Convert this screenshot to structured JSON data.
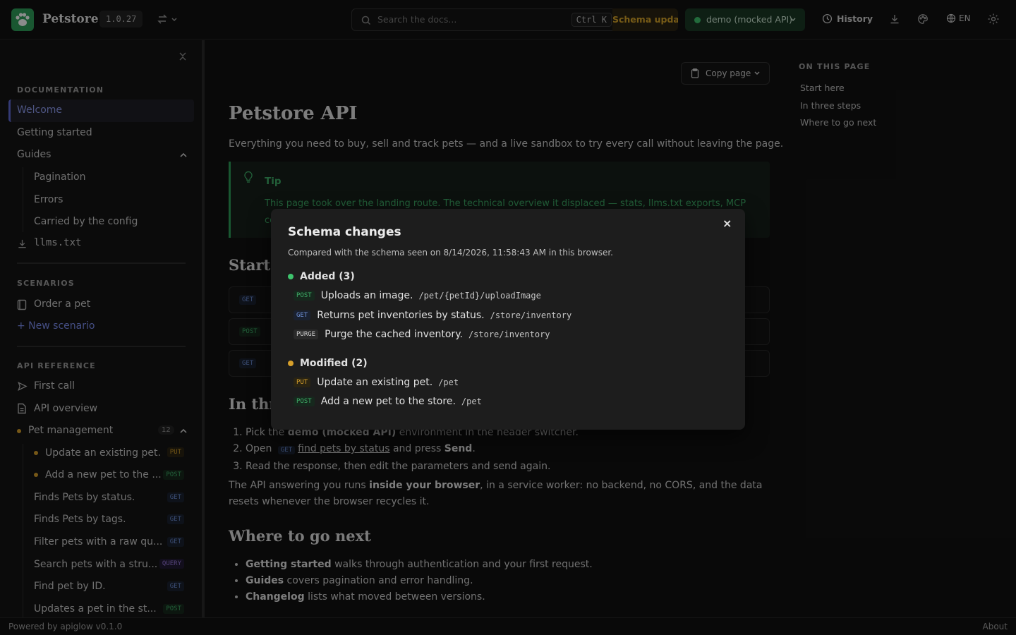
{
  "header": {
    "brand": "Petstore",
    "version": "1.0.27",
    "search_placeholder": "Search the docs...",
    "search_shortcut": "Ctrl K",
    "schema_badge": "Schema updated",
    "environment": "demo (mocked API)",
    "history": "History",
    "language": "EN"
  },
  "sidebar": {
    "documentation_title": "DOCUMENTATION",
    "doc_items": [
      "Welcome",
      "Getting started",
      "Guides"
    ],
    "guide_items": [
      "Pagination",
      "Errors",
      "Carried by the config"
    ],
    "llms": "llms.txt",
    "scenarios_title": "SCENARIOS",
    "scenario_item": "Order a pet",
    "new_scenario": "+ New scenario",
    "api_title": "API REFERENCE",
    "first_call": "First call",
    "api_overview": "API overview",
    "pet_group": "Pet management",
    "pet_count": "12",
    "endpoints": [
      {
        "label": "Update an existing pet.",
        "method": "PUT"
      },
      {
        "label": "Add a new pet to the ...",
        "method": "POST"
      },
      {
        "label": "Finds Pets by status.",
        "method": "GET"
      },
      {
        "label": "Finds Pets by tags.",
        "method": "GET"
      },
      {
        "label": "Filter pets with a raw qu...",
        "method": "GET"
      },
      {
        "label": "Search pets with a stru...",
        "method": "QUERY"
      },
      {
        "label": "Find pet by ID.",
        "method": "GET"
      },
      {
        "label": "Updates a pet in the st...",
        "method": "POST"
      }
    ]
  },
  "main": {
    "copy_page": "Copy page",
    "title": "Petstore API",
    "lead": "Everything you need to buy, sell and track pets — and a live sandbox to try every call without leaving the page.",
    "tip_label": "Tip",
    "tip_text": "This page took over the landing route. The technical overview it displaced — stats, llms.txt exports, MCP co",
    "h2_start": "Start here",
    "start_methods": [
      "GET",
      "POST",
      "GET"
    ],
    "h2_steps": "In three steps",
    "step1_a": "Pick the ",
    "step1_b": "demo (mocked API)",
    "step1_c": " environment in the header switcher.",
    "step2_a": "Open",
    "step2_method": "GET",
    "step2_link": "find pets by status",
    "step2_b": " and press ",
    "step2_c": "Send",
    "step2_d": ".",
    "step3": "Read the response, then edit the parameters and send again.",
    "para_a": "The API answering you runs ",
    "para_b": "inside your browser",
    "para_c": ", in a service worker: no backend, no CORS, and the data resets whenever the browser recycles it.",
    "h2_next": "Where to go next",
    "next": [
      {
        "bold": "Getting started",
        "rest": " walks through authentication and your first request."
      },
      {
        "bold": "Guides",
        "rest": " covers pagination and error handling."
      },
      {
        "bold": "Changelog",
        "rest": " lists what moved between versions."
      }
    ]
  },
  "toc": {
    "title": "ON THIS PAGE",
    "items": [
      "Start here",
      "In three steps",
      "Where to go next"
    ]
  },
  "dialog": {
    "title": "Schema changes",
    "subtitle": "Compared with the schema seen on 8/14/2026, 11:58:43 AM in this browser.",
    "added_title": "Added (3)",
    "added": [
      {
        "method": "POST",
        "summary": "Uploads an image.",
        "path": "/pet/{petId}/uploadImage"
      },
      {
        "method": "GET",
        "summary": "Returns pet inventories by status.",
        "path": "/store/inventory"
      },
      {
        "method": "PURGE",
        "summary": "Purge the cached inventory.",
        "path": "/store/inventory"
      }
    ],
    "modified_title": "Modified (2)",
    "modified": [
      {
        "method": "PUT",
        "summary": "Update an existing pet.",
        "path": "/pet"
      },
      {
        "method": "POST",
        "summary": "Add a new pet to the store.",
        "path": "/pet"
      }
    ],
    "close": "×"
  },
  "footer": {
    "powered": "Powered by apiglow v0.1.0",
    "about": "About"
  },
  "colors": {
    "accent": "#5f6ad6",
    "success": "#3fae68",
    "warning": "#d7a02b"
  }
}
